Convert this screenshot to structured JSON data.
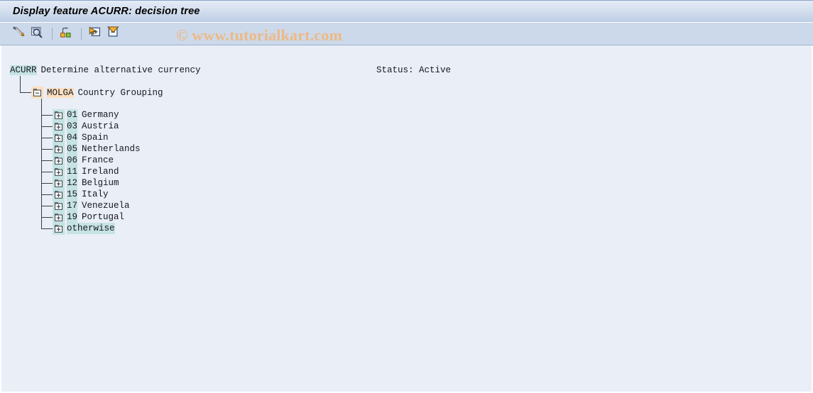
{
  "window": {
    "title": "Display feature ACURR: decision tree"
  },
  "watermark": {
    "text": "© www.tutorialkart.com",
    "color": "#edb986"
  },
  "toolbar": {
    "buttons": [
      {
        "name": "change-button",
        "icon": "pencil-icon",
        "tooltip": "Change"
      },
      {
        "name": "display-button",
        "icon": "magnifier-icon",
        "tooltip": "Display"
      },
      {
        "name": "structure-button",
        "icon": "hierarchy-icon",
        "tooltip": "Structure"
      },
      {
        "name": "expand-all-button",
        "icon": "expand-node-icon",
        "tooltip": "Expand subtree"
      },
      {
        "name": "collapse-all-button",
        "icon": "collapse-node-icon",
        "tooltip": "Collapse subtree"
      }
    ]
  },
  "header": {
    "feature_id": "ACURR",
    "feature_text": "Determine alternative currency",
    "status_label": "Status:",
    "status_value": "Active",
    "status_full": "Status: Active"
  },
  "tree": {
    "root": {
      "id": "ACURR",
      "label": "Determine alternative currency",
      "highlight_color": "#c5e3e3"
    },
    "field_node": {
      "id": "MOLGA",
      "label": "Country Grouping",
      "icon": "collapse-node-icon",
      "expanded": true,
      "highlight_color": "#fbdfc0"
    },
    "children_highlight_color": "#c5e3e3",
    "children": [
      {
        "code": "01",
        "label": "Germany",
        "icon": "expand-node-icon"
      },
      {
        "code": "03",
        "label": "Austria",
        "icon": "expand-node-icon"
      },
      {
        "code": "04",
        "label": "Spain",
        "icon": "expand-node-icon"
      },
      {
        "code": "05",
        "label": "Netherlands",
        "icon": "expand-node-icon"
      },
      {
        "code": "06",
        "label": "France",
        "icon": "expand-node-icon"
      },
      {
        "code": "11",
        "label": "Ireland",
        "icon": "expand-node-icon"
      },
      {
        "code": "12",
        "label": "Belgium",
        "icon": "expand-node-icon"
      },
      {
        "code": "15",
        "label": "Italy",
        "icon": "expand-node-icon"
      },
      {
        "code": "17",
        "label": "Venezuela",
        "icon": "expand-node-icon"
      },
      {
        "code": "19",
        "label": "Portugal",
        "icon": "expand-node-icon"
      },
      {
        "code": "otherwise",
        "label": "",
        "icon": "expand-node-icon"
      }
    ]
  },
  "colors": {
    "title_bar_top": "#e3ebf6",
    "title_bar_bottom": "#bccde4",
    "toolbar_bg": "#ccd9ea",
    "content_bg": "#e9eef7",
    "tree_line": "#3b3b44",
    "text": "#18181f"
  }
}
